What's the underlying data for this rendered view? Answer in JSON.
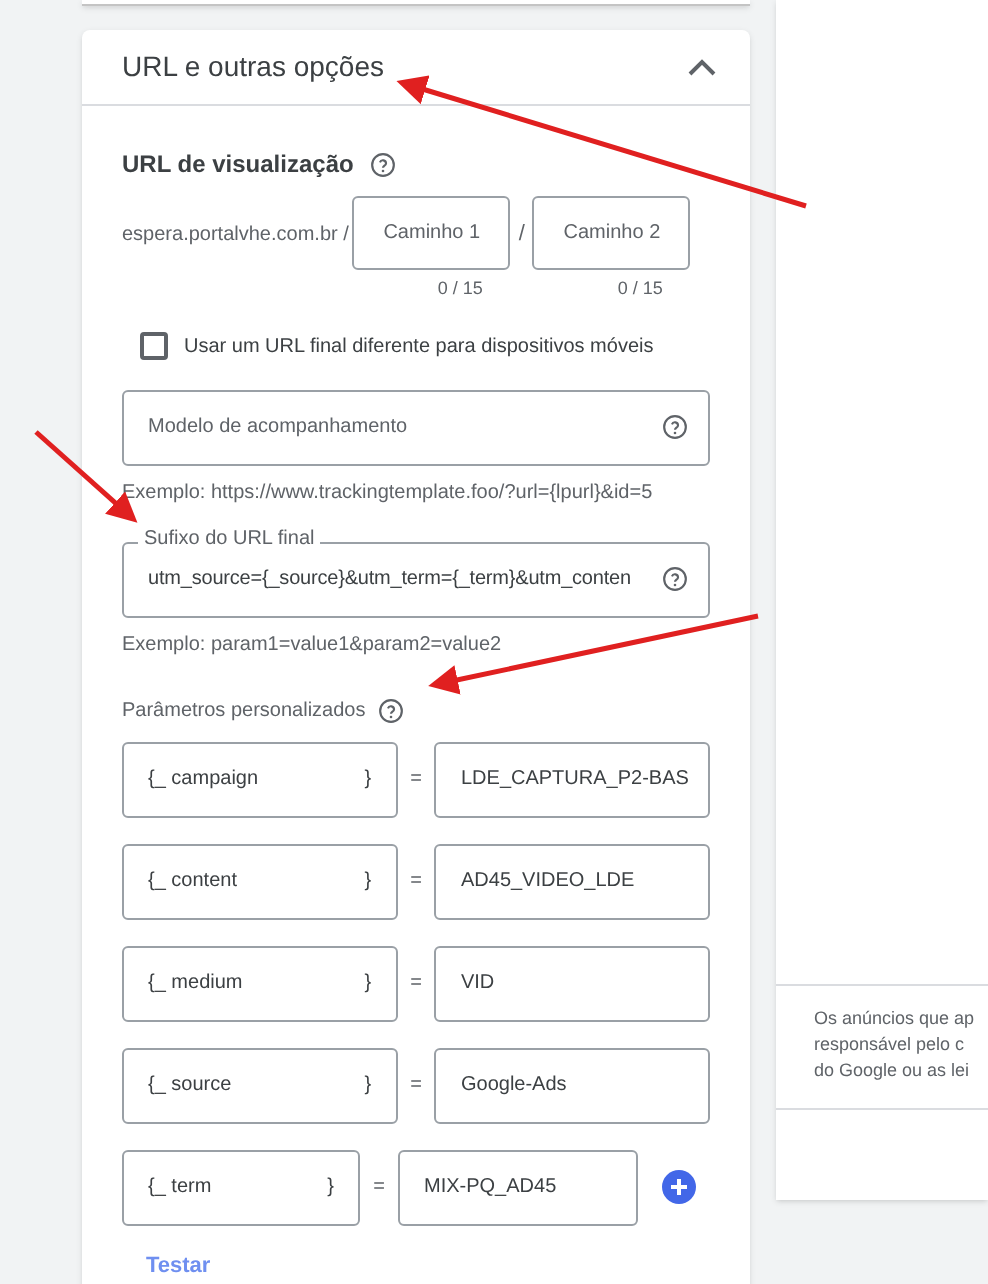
{
  "section": {
    "title": "URL e outras opções",
    "expanded": true
  },
  "display_url": {
    "label": "URL de visualização",
    "domain": "espera.portalvhe.com.br /",
    "separator": "/",
    "paths": [
      {
        "placeholder": "Caminho 1",
        "counter": "0 / 15"
      },
      {
        "placeholder": "Caminho 2",
        "counter": "0 / 15"
      }
    ]
  },
  "mobile_url": {
    "label": "Usar um URL final diferente para dispositivos móveis",
    "checked": false
  },
  "tracking_template": {
    "placeholder": "Modelo de acompanhamento",
    "example": "Exemplo: https://www.trackingtemplate.foo/?url={lpurl}&id=5"
  },
  "final_url_suffix": {
    "label": "Sufixo do URL final",
    "value": "utm_source={_source}&utm_term={_term}&utm_conten",
    "example": "Exemplo: param1=value1&param2=value2"
  },
  "custom_parameters": {
    "label": "Parâmetros personalizados",
    "params": [
      {
        "key": "{_ campaign",
        "close": "}",
        "equals": "=",
        "value": "LDE_CAPTURA_P2-BAS"
      },
      {
        "key": "{_ content",
        "close": "}",
        "equals": "=",
        "value": "AD45_VIDEO_LDE"
      },
      {
        "key": "{_ medium",
        "close": "}",
        "equals": "=",
        "value": "VID"
      },
      {
        "key": "{_ source",
        "close": "}",
        "equals": "=",
        "value": "Google-Ads"
      },
      {
        "key": "{_ term",
        "close": "}",
        "equals": "=",
        "value": "MIX-PQ_AD45",
        "addable": true
      }
    ],
    "test_link": "Testar"
  },
  "side_panel": {
    "lines": [
      "Os anúncios que ap",
      "responsável pelo c",
      "do Google ou as lei"
    ]
  }
}
